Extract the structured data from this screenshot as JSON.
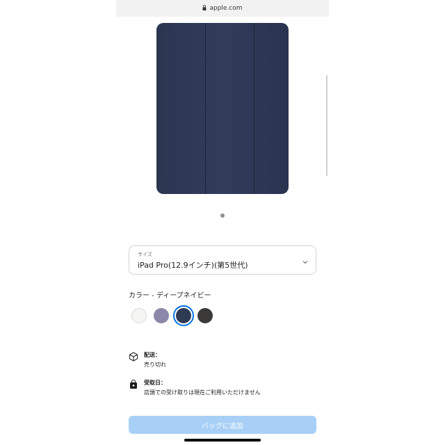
{
  "browser": {
    "url": "apple.com"
  },
  "product": {
    "image_alt_icon": "ipad-case-product-image",
    "carousel": {
      "page": 1,
      "total": 1
    }
  },
  "size_selector": {
    "label": "サイズ",
    "value": "iPad Pro(12.9インチ)(第5世代)"
  },
  "color": {
    "title": "カラー - ディープネイビー",
    "swatches": [
      {
        "name": "white",
        "hex": "#f5f5f2",
        "selected": false
      },
      {
        "name": "lavender",
        "hex": "#8a87a8",
        "selected": false
      },
      {
        "name": "deep-navy",
        "hex": "#2f3a55",
        "selected": true
      },
      {
        "name": "charcoal",
        "hex": "#3b3a39",
        "selected": false
      }
    ]
  },
  "delivery": {
    "title": "配送：",
    "status": "売り切れ"
  },
  "pickup": {
    "title": "受取日：",
    "status": "店頭での受け取りは現在ご利用いただけません"
  },
  "add_to_bag": {
    "label": "バッグに追加",
    "color": "#a8d0f7"
  }
}
